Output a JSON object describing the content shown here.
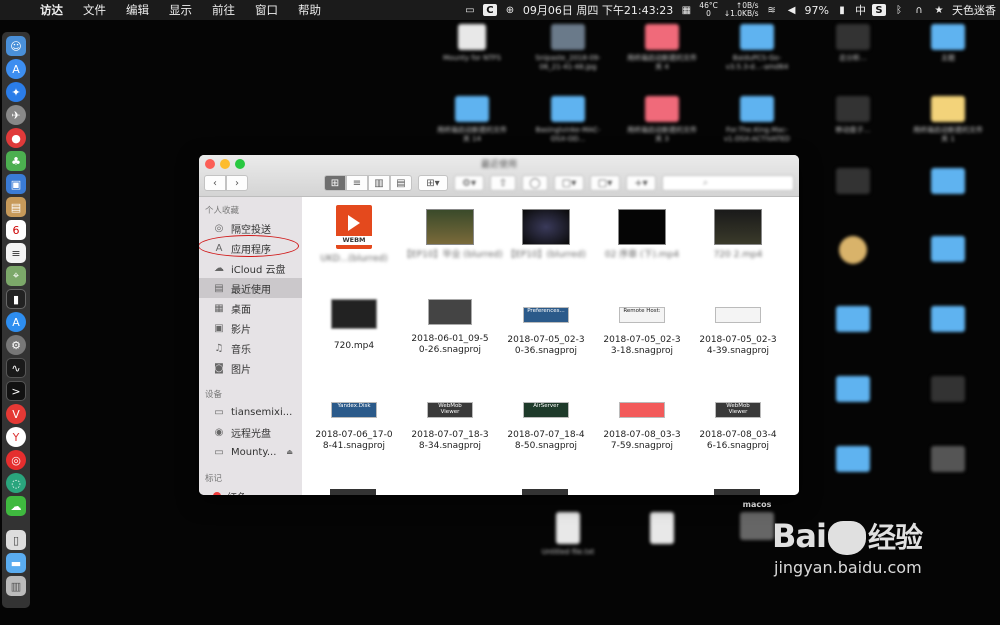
{
  "menubar": {
    "apple": "",
    "items": [
      "访达",
      "文件",
      "编辑",
      "显示",
      "前往",
      "窗口",
      "帮助"
    ],
    "clock": "09月06日 周四 下午21:43:23",
    "temp_top": "46°C",
    "temp_bottom": "0",
    "net_up": "↑0B/s",
    "net_down": "↓1.0KB/s",
    "battery": "97%",
    "input": "中",
    "user": "天色迷香"
  },
  "window": {
    "title": "最近使用"
  },
  "sidebar": {
    "favorites_header": "个人收藏",
    "favorites": [
      {
        "label": "隔空投送",
        "icon": "airdrop-icon",
        "glyph": "◎"
      },
      {
        "label": "应用程序",
        "icon": "applications-icon",
        "glyph": "A"
      },
      {
        "label": "iCloud 云盘",
        "icon": "cloud-icon",
        "glyph": "☁"
      },
      {
        "label": "最近使用",
        "icon": "recents-icon",
        "glyph": "▤"
      },
      {
        "label": "桌面",
        "icon": "desktop-icon",
        "glyph": "▦"
      },
      {
        "label": "影片",
        "icon": "movies-icon",
        "glyph": "▣"
      },
      {
        "label": "音乐",
        "icon": "music-icon",
        "glyph": "♫"
      },
      {
        "label": "图片",
        "icon": "pictures-icon",
        "glyph": "◙"
      }
    ],
    "devices_header": "设备",
    "devices": [
      {
        "label": "tiansemixi...",
        "icon": "computer-icon",
        "glyph": "▭"
      },
      {
        "label": "远程光盘",
        "icon": "disc-icon",
        "glyph": "◉"
      },
      {
        "label": "Mounty...",
        "icon": "drive-icon",
        "glyph": "▭"
      }
    ],
    "tags_header": "标记",
    "tags": [
      {
        "label": "红色"
      }
    ]
  },
  "files": [
    {
      "name": "UKD...(blurred)",
      "kind": "webm",
      "blur": true
    },
    {
      "name": "【EP10】毕业 (blurred)",
      "kind": "video",
      "blur": true
    },
    {
      "name": "【EP10】(blurred)",
      "kind": "video-dark",
      "blur": true
    },
    {
      "name": "02 序章 (下).mp4",
      "kind": "video-black",
      "blur": true
    },
    {
      "name": "720 2.mp4",
      "kind": "video",
      "blur": true
    },
    {
      "name": "720.mp4",
      "kind": "video-small",
      "blur": false
    },
    {
      "name": "2018-06-01_09-5\n0-26.snagproj",
      "kind": "snag-window",
      "blur": false
    },
    {
      "name": "2018-07-05_02-3\n0-36.snagproj",
      "kind": "snag-blue",
      "label": "Preferences...",
      "blur": false
    },
    {
      "name": "2018-07-05_02-3\n3-18.snagproj",
      "kind": "snag-white",
      "label": "Remote Host:",
      "blur": false
    },
    {
      "name": "2018-07-05_02-3\n4-39.snagproj",
      "kind": "snag-white2",
      "label": "",
      "blur": false
    },
    {
      "name": "2018-07-06_17-0\n8-41.snagproj",
      "kind": "snag-blue",
      "label": "Yandex.Disk",
      "blur": false
    },
    {
      "name": "2018-07-07_18-3\n8-34.snagproj",
      "kind": "snag-dark",
      "label": "WebMob Viewer",
      "blur": false
    },
    {
      "name": "2018-07-07_18-4\n8-50.snagproj",
      "kind": "snag-green",
      "label": "AirServer",
      "blur": false
    },
    {
      "name": "2018-07-08_03-3\n7-59.snagproj",
      "kind": "snag-red",
      "label": "",
      "blur": false
    },
    {
      "name": "2018-07-08_03-4\n6-16.snagproj",
      "kind": "snag-dark",
      "label": "WebMob Viewer",
      "blur": false
    }
  ],
  "desktop": [
    {
      "label": "Mounty for NTFS",
      "color": "#e8e8e8"
    },
    {
      "label": "Snipaste_2018-09-06_21-41-48.jpg",
      "color": "#6a7a8a"
    },
    {
      "label": "用终端启动新建的文件夹 4",
      "color": "#f06a7a"
    },
    {
      "label": "BaiduPCS-Go-v3.5.3-d...-amd64",
      "color": "#5fb3f0"
    },
    {
      "label": "总分析…",
      "color": "#333"
    },
    {
      "label": "主题",
      "color": "#5fb3f0"
    },
    {
      "label": "用终端启动新建的文件夹 14",
      "color": "#5fb3f0"
    },
    {
      "label": "Basinglvinke-MAC-OSX-OD...",
      "color": "#5fb3f0"
    },
    {
      "label": "用终端启动新建的文件夹 3",
      "color": "#f06a7a"
    },
    {
      "label": "For.The.King.Mac-v1.OSX-ACTIVATED",
      "color": "#5fb3f0"
    },
    {
      "label": "移动盘子…",
      "color": "#333"
    },
    {
      "label": "用终端启动新建的文件夹 1",
      "color": "#f3d37a"
    },
    {
      "label": "macos",
      "color": "#000"
    },
    {
      "label": "Untitled file.txt",
      "color": "#e8e8e8"
    }
  ],
  "watermark": {
    "brand_left": "Bai",
    "brand_right": "经验",
    "url": "jingyan.baidu.com"
  },
  "colors": {
    "dock_bg": "#3c3c3c",
    "selection": "#cbc8cb",
    "highlight_oval": "#d01818",
    "tag_red": "#ef3b3b"
  }
}
